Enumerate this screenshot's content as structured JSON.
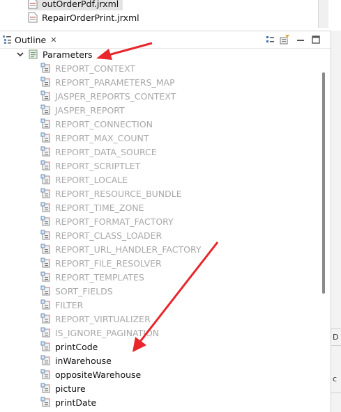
{
  "files": [
    {
      "name": "outOrderPdf.jrxml",
      "selected": true
    },
    {
      "name": "RepairOrderPrint.jrxml",
      "selected": false
    }
  ],
  "outline": {
    "tab_label": "Outline",
    "close_glyph": "✕",
    "header_buttons": [
      "sort-icon",
      "filter-icon",
      "minimize-icon",
      "maximize-icon"
    ]
  },
  "tree": {
    "root_label": "Parameters",
    "root_expanded": true,
    "items": [
      {
        "label": "REPORT_CONTEXT",
        "style": "gray"
      },
      {
        "label": "REPORT_PARAMETERS_MAP",
        "style": "gray"
      },
      {
        "label": "JASPER_REPORTS_CONTEXT",
        "style": "gray"
      },
      {
        "label": "JASPER_REPORT",
        "style": "gray"
      },
      {
        "label": "REPORT_CONNECTION",
        "style": "gray"
      },
      {
        "label": "REPORT_MAX_COUNT",
        "style": "gray"
      },
      {
        "label": "REPORT_DATA_SOURCE",
        "style": "gray"
      },
      {
        "label": "REPORT_SCRIPTLET",
        "style": "gray"
      },
      {
        "label": "REPORT_LOCALE",
        "style": "gray"
      },
      {
        "label": "REPORT_RESOURCE_BUNDLE",
        "style": "gray"
      },
      {
        "label": "REPORT_TIME_ZONE",
        "style": "gray"
      },
      {
        "label": "REPORT_FORMAT_FACTORY",
        "style": "gray"
      },
      {
        "label": "REPORT_CLASS_LOADER",
        "style": "gray"
      },
      {
        "label": "REPORT_URL_HANDLER_FACTORY",
        "style": "gray"
      },
      {
        "label": "REPORT_FILE_RESOLVER",
        "style": "gray"
      },
      {
        "label": "REPORT_TEMPLATES",
        "style": "gray"
      },
      {
        "label": "SORT_FIELDS",
        "style": "gray"
      },
      {
        "label": "FILTER",
        "style": "gray"
      },
      {
        "label": "REPORT_VIRTUALIZER",
        "style": "gray"
      },
      {
        "label": "IS_IGNORE_PAGINATION",
        "style": "gray"
      },
      {
        "label": "printCode",
        "style": "dark"
      },
      {
        "label": "inWarehouse",
        "style": "dark"
      },
      {
        "label": "oppositeWarehouse",
        "style": "dark"
      },
      {
        "label": "picture",
        "style": "dark"
      },
      {
        "label": "printDate",
        "style": "dark"
      }
    ]
  },
  "right_panel": {
    "labels": [
      "D",
      "c"
    ]
  },
  "annotation_color": "#e8262b"
}
